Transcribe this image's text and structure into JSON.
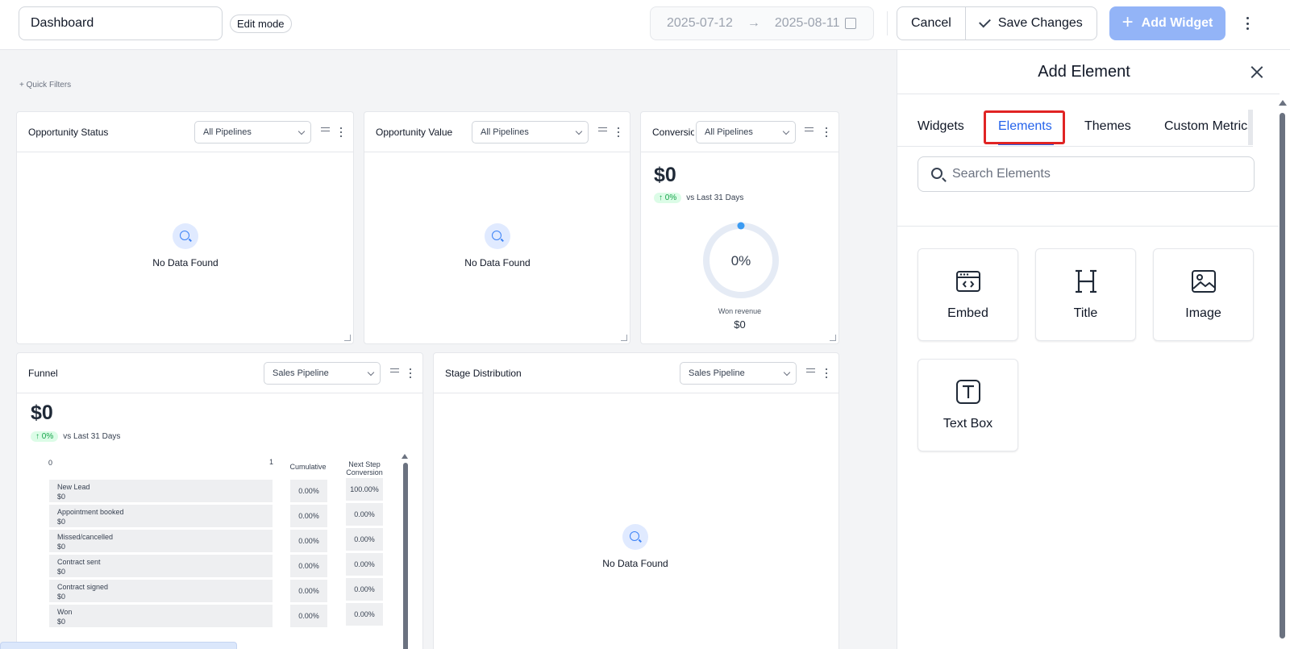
{
  "topbar": {
    "dashboard_name": "Dashboard",
    "edit_mode": "Edit mode",
    "date_start": "2025-07-12",
    "date_end": "2025-08-11",
    "cancel": "Cancel",
    "save": "Save Changes",
    "add_widget": "Add Widget"
  },
  "canvas": {
    "quick_filters": "+ Quick Filters",
    "no_data": "No Data Found",
    "widgets": {
      "opportunity_status": {
        "title": "Opportunity Status",
        "pipeline": "All Pipelines"
      },
      "opportunity_value": {
        "title": "Opportunity Value",
        "pipeline": "All Pipelines"
      },
      "conversion": {
        "title": "Conversion",
        "pipeline": "All Pipelines",
        "value": "$0",
        "delta": "↑ 0%",
        "delta_text": "vs Last 31 Days",
        "gauge_label": "0%",
        "gauge_percent": 0,
        "won_revenue_label": "Won revenue",
        "won_revenue_value": "$0"
      },
      "funnel": {
        "title": "Funnel",
        "pipeline": "Sales Pipeline",
        "value": "$0",
        "delta": "↑ 0%",
        "delta_text": "vs Last 31 Days",
        "axis_min": "0",
        "axis_max": "1",
        "col_cumulative": "Cumulative",
        "col_next_line1": "Next Step",
        "col_next_line2": "Conversion",
        "stages": [
          {
            "name": "New Lead",
            "value": "$0",
            "cumulative": "0.00%",
            "next": "100.00%"
          },
          {
            "name": "Appointment booked",
            "value": "$0",
            "cumulative": "0.00%",
            "next": "0.00%"
          },
          {
            "name": "Missed/cancelled",
            "value": "$0",
            "cumulative": "0.00%",
            "next": "0.00%"
          },
          {
            "name": "Contract sent",
            "value": "$0",
            "cumulative": "0.00%",
            "next": "0.00%"
          },
          {
            "name": "Contract signed",
            "value": "$0",
            "cumulative": "0.00%",
            "next": "0.00%"
          },
          {
            "name": "Won",
            "value": "$0",
            "cumulative": "0.00%",
            "next": "0.00%"
          }
        ]
      },
      "stage_distribution": {
        "title": "Stage Distribution",
        "pipeline": "Sales Pipeline"
      }
    }
  },
  "panel": {
    "title": "Add Element",
    "tabs": [
      "Widgets",
      "Elements",
      "Themes",
      "Custom Metrics"
    ],
    "active_tab": "Elements",
    "search_placeholder": "Search Elements",
    "elements": [
      "Embed",
      "Title",
      "Image",
      "Text Box"
    ]
  },
  "colors": {
    "accent": "#2563eb",
    "add_widget_bg": "#93b4f7",
    "highlight": "#e02424"
  }
}
